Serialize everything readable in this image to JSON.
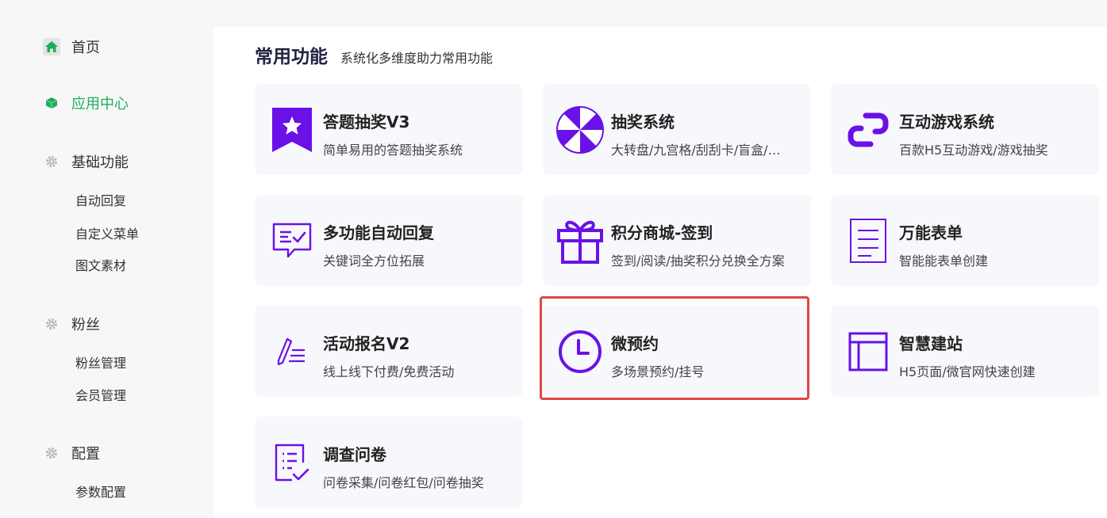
{
  "colors": {
    "accent_green": "#1dae5a",
    "brand_purple": "#6a11e8",
    "highlight_red": "#e04646"
  },
  "sidebar": {
    "items": [
      {
        "label": "首页",
        "icon": "home-icon"
      },
      {
        "label": "应用中心",
        "icon": "cube-icon",
        "active": true
      },
      {
        "label": "基础功能",
        "icon": "gear-icon"
      },
      {
        "label": "粉丝",
        "icon": "gear-icon"
      },
      {
        "label": "配置",
        "icon": "gear-icon"
      }
    ],
    "sub_items": [
      "自动回复",
      "自定义菜单",
      "图文素材",
      "粉丝管理",
      "会员管理",
      "参数配置"
    ]
  },
  "main": {
    "title": "常用功能",
    "subtitle": "系统化多维度助力常用功能",
    "cards": [
      {
        "title": "答题抽奖V3",
        "desc": "简单易用的答题抽奖系统",
        "icon": "ribbon-star-icon"
      },
      {
        "title": "抽奖系统",
        "desc": "大转盘/九宫格/刮刮卡/盲盒/…",
        "icon": "wheel-icon"
      },
      {
        "title": "互动游戏系统",
        "desc": "百款H5互动游戏/游戏抽奖",
        "icon": "link-icon"
      },
      {
        "title": "多功能自动回复",
        "desc": "关键词全方位拓展",
        "icon": "chat-check-icon"
      },
      {
        "title": "积分商城-签到",
        "desc": "签到/阅读/抽奖积分兑换全方案",
        "icon": "gift-icon"
      },
      {
        "title": "万能表单",
        "desc": "智能能表单创建",
        "icon": "form-icon"
      },
      {
        "title": "活动报名V2",
        "desc": "线上线下付费/免费活动",
        "icon": "pen-list-icon"
      },
      {
        "title": "微预约",
        "desc": "多场景预约/挂号",
        "icon": "clock-icon"
      },
      {
        "title": "智慧建站",
        "desc": "H5页面/微官网快速创建",
        "icon": "layout-icon"
      },
      {
        "title": "调查问卷",
        "desc": "问卷采集/问卷红包/问卷抽奖",
        "icon": "survey-icon"
      }
    ]
  }
}
